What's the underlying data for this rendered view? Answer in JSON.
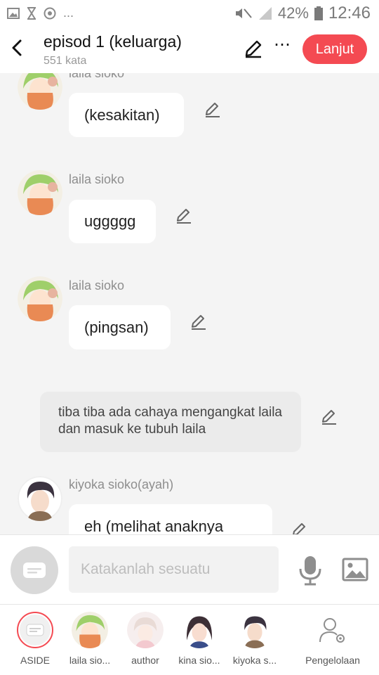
{
  "status_bar": {
    "left_extra": "...",
    "battery": "42%",
    "time": "12:46"
  },
  "header": {
    "title": "episod 1 (keluarga)",
    "word_count": "551 kata",
    "next_button": "Lanjut"
  },
  "messages": [
    {
      "sender": "laila sioko",
      "text": "(kesakitan)"
    },
    {
      "sender": "laila sioko",
      "text": "uggggg"
    },
    {
      "sender": "laila sioko",
      "text": "(pingsan)"
    },
    {
      "narration": "tiba tiba ada cahaya mengangkat laila dan masuk ke tubuh laila"
    },
    {
      "sender": "kiyoka sioko(ayah)",
      "text": "eh (melihat anaknya"
    }
  ],
  "input": {
    "placeholder": "Katakanlah sesuatu"
  },
  "tray": [
    {
      "label": "ASIDE"
    },
    {
      "label": "laila sio..."
    },
    {
      "label": "author"
    },
    {
      "label": "kina sio..."
    },
    {
      "label": "kiyoka s..."
    },
    {
      "label": "Pengelolaan"
    }
  ],
  "colors": {
    "accent": "#f44a52",
    "bubble": "#ffffff",
    "narration": "#ebebeb"
  }
}
